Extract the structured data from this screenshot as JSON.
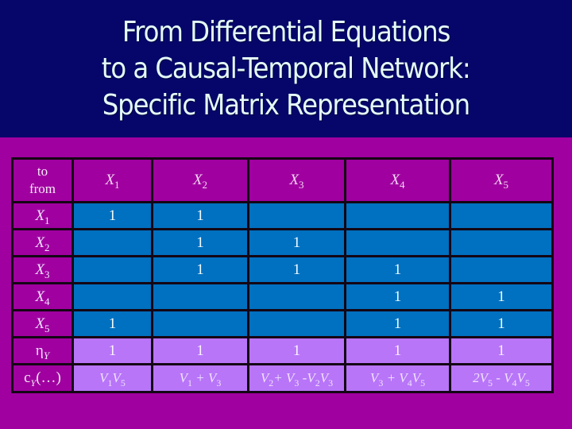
{
  "title": {
    "lines": [
      "From Differential Equations",
      "to a Causal-Temporal Network:",
      "Specific Matrix Representation"
    ]
  },
  "colors": {
    "title_background": "#06066a",
    "slide_background": "#a000a0",
    "matrix_cell": "#0070c0",
    "function_cell": "#b875f8",
    "title_text": "#e4fbf8"
  },
  "table": {
    "corner": {
      "top": "to",
      "bottom": "from"
    },
    "columns": [
      {
        "name": "X",
        "sub": "1"
      },
      {
        "name": "X",
        "sub": "2"
      },
      {
        "name": "X",
        "sub": "3"
      },
      {
        "name": "X",
        "sub": "4"
      },
      {
        "name": "X",
        "sub": "5"
      }
    ],
    "rows": [
      {
        "label": "X",
        "sub": "1",
        "cells": [
          "1",
          "1",
          "",
          "",
          ""
        ]
      },
      {
        "label": "X",
        "sub": "2",
        "cells": [
          "",
          "1",
          "1",
          "",
          ""
        ]
      },
      {
        "label": "X",
        "sub": "3",
        "cells": [
          "",
          "1",
          "1",
          "1",
          ""
        ]
      },
      {
        "label": "X",
        "sub": "4",
        "cells": [
          "",
          "",
          "",
          "1",
          "1"
        ]
      },
      {
        "label": "X",
        "sub": "5",
        "cells": [
          "1",
          "",
          "",
          "1",
          "1"
        ]
      }
    ],
    "eta_row": {
      "label": "η",
      "sub": "Y",
      "cells": [
        "1",
        "1",
        "1",
        "1",
        "1"
      ]
    },
    "c_row": {
      "label_main": "c",
      "label_sub": "Y",
      "label_tail": "(…)",
      "cells": [
        [
          [
            "V",
            "1",
            ""
          ],
          [
            "V",
            "5",
            ""
          ]
        ],
        [
          [
            "V",
            "1",
            " + "
          ],
          [
            "V",
            "3",
            ""
          ]
        ],
        [
          [
            "V",
            "2",
            "+ "
          ],
          [
            "V",
            "3",
            " -"
          ],
          [
            "V",
            "2",
            ""
          ],
          [
            "V",
            "3",
            ""
          ]
        ],
        [
          [
            "V",
            "3",
            " + "
          ],
          [
            "V",
            "4",
            ""
          ],
          [
            "V",
            "5",
            ""
          ]
        ],
        [
          [
            "2V",
            "5",
            " - "
          ],
          [
            "V",
            "4",
            ""
          ],
          [
            "V",
            "5",
            ""
          ]
        ]
      ]
    }
  }
}
